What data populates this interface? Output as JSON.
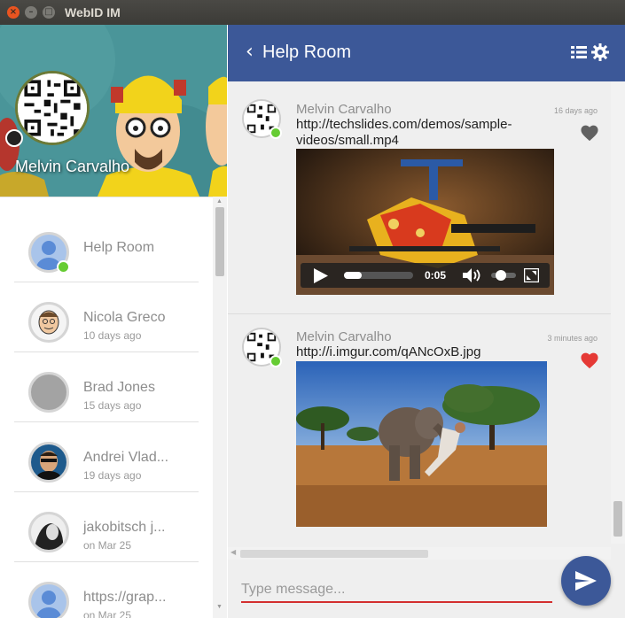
{
  "window": {
    "title": "WebID IM"
  },
  "profile": {
    "name": "Melvin Carvalho"
  },
  "contacts": [
    {
      "name": "Help Room",
      "time": "",
      "online": true
    },
    {
      "name": "Nicola Greco",
      "time": "10 days ago",
      "online": false
    },
    {
      "name": "Brad Jones",
      "time": "15 days ago",
      "online": false
    },
    {
      "name": "Andrei Vlad...",
      "time": "19 days ago",
      "online": false
    },
    {
      "name": "jakobitsch j...",
      "time": "on Mar 25",
      "online": false
    },
    {
      "name": "https://grap...",
      "time": "on Mar 25",
      "online": false
    }
  ],
  "room": {
    "title": "Help Room"
  },
  "messages": [
    {
      "sender": "Melvin Carvalho",
      "time": "16 days ago",
      "link": "http://techslides.com/demos/sample-videos/small.mp4",
      "liked": false,
      "video": {
        "time": "0:05",
        "progress": 0.25,
        "volume": 0.3
      }
    },
    {
      "sender": "Melvin Carvalho",
      "time": "3 minutes ago",
      "link": "http://i.imgur.com/qANcOxB.jpg",
      "liked": true
    }
  ],
  "composer": {
    "placeholder": "Type message..."
  },
  "colors": {
    "accent": "#3c5898",
    "online": "#66cc33",
    "liked": "#e53935",
    "unliked": "#616161",
    "underline": "#d32f2f"
  }
}
